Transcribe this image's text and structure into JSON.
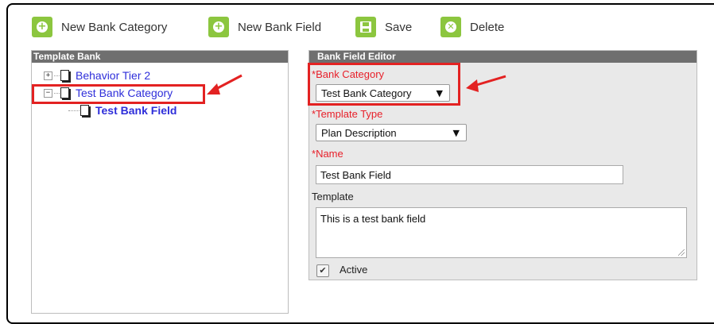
{
  "toolbar": {
    "new_category_label": "New Bank Category",
    "new_field_label": "New Bank Field",
    "save_label": "Save",
    "delete_label": "Delete",
    "accent_color": "#8cc63f"
  },
  "template_bank": {
    "title": "Template Bank",
    "items": [
      {
        "label": "Behavior Tier 2",
        "expander": "+"
      },
      {
        "label": "Test Bank Category",
        "expander": "−"
      },
      {
        "label": "Test Bank Field"
      }
    ]
  },
  "editor": {
    "title": "Bank Field Editor",
    "required_marker": "*",
    "bank_category_label": "Bank Category",
    "bank_category_value": "Test Bank Category",
    "template_type_label": "Template Type",
    "template_type_value": "Plan Description",
    "name_label": "Name",
    "name_value": "Test Bank Field",
    "template_label": "Template",
    "template_value": "This is a test bank field",
    "active_label": "Active",
    "active_checked": true
  },
  "annotation_color": "#e32222"
}
